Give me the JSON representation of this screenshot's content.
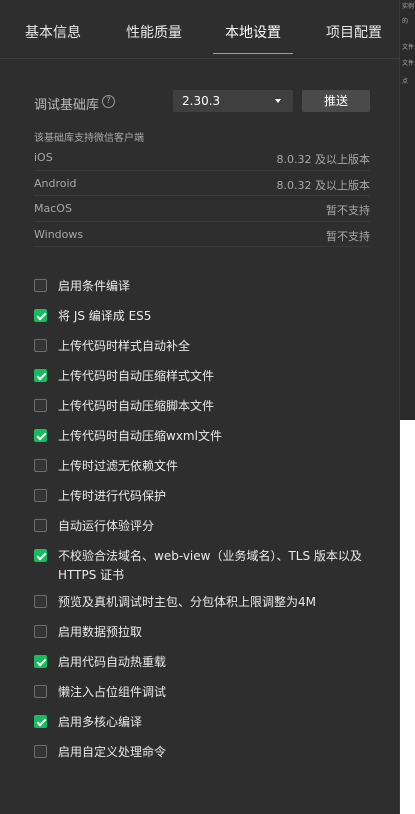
{
  "tabs": [
    {
      "label": "基本信息",
      "active": false
    },
    {
      "label": "性能质量",
      "active": false
    },
    {
      "label": "本地设置",
      "active": true
    },
    {
      "label": "项目配置",
      "active": false
    }
  ],
  "base_library": {
    "label": "调试基础库",
    "help_glyph": "?",
    "version": "2.30.3",
    "push_label": "推送"
  },
  "support": {
    "heading": "该基础库支持微信客户端",
    "rows": [
      {
        "platform": "iOS",
        "requirement": "8.0.32 及以上版本"
      },
      {
        "platform": "Android",
        "requirement": "8.0.32 及以上版本"
      },
      {
        "platform": "MacOS",
        "requirement": "暂不支持"
      },
      {
        "platform": "Windows",
        "requirement": "暂不支持"
      }
    ]
  },
  "options": [
    {
      "label": "启用条件编译",
      "checked": false
    },
    {
      "label": "将 JS 编译成 ES5",
      "checked": true
    },
    {
      "label": "上传代码时样式自动补全",
      "checked": false
    },
    {
      "label": "上传代码时自动压缩样式文件",
      "checked": true
    },
    {
      "label": "上传代码时自动压缩脚本文件",
      "checked": false
    },
    {
      "label": "上传代码时自动压缩wxml文件",
      "checked": true
    },
    {
      "label": "上传时过滤无依赖文件",
      "checked": false
    },
    {
      "label": "上传时进行代码保护",
      "checked": false
    },
    {
      "label": "自动运行体验评分",
      "checked": false
    },
    {
      "label": "不校验合法域名、web-view（业务域名）、TLS 版本以及 HTTPS 证书",
      "checked": true
    },
    {
      "label": "预览及真机调试时主包、分包体积上限调整为4M",
      "checked": false
    },
    {
      "label": "启用数据预拉取",
      "checked": false
    },
    {
      "label": "启用代码自动热重载",
      "checked": true
    },
    {
      "label": "懒注入占位组件调试",
      "checked": false
    },
    {
      "label": "启用多核心编译",
      "checked": true
    },
    {
      "label": "启用自定义处理命令",
      "checked": false
    }
  ],
  "background_fragments": [
    "实例",
    "的",
    "文件",
    "文件",
    "点"
  ],
  "colors": {
    "panel": "#2e2e2f",
    "accent_check": "#19b95f"
  }
}
